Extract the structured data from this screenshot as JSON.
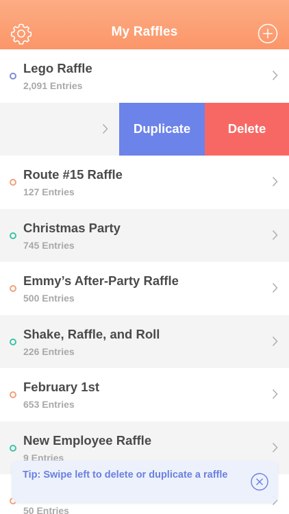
{
  "header": {
    "title": "My Raffles",
    "settings_icon": "gear-icon",
    "add_icon": "plus-circle-icon"
  },
  "colors": {
    "header_top": "#fdac84",
    "header_bottom": "#fb9669",
    "duplicate": "#6c83ea",
    "delete": "#f76864",
    "dot_blue": "#7c8ad8",
    "dot_orange": "#f2a07a",
    "dot_teal": "#3cc3a6",
    "tip_text": "#6a7fe0"
  },
  "swipe_actions": {
    "duplicate_label": "Duplicate",
    "delete_label": "Delete"
  },
  "raffles": [
    {
      "name": "Lego Raffle",
      "entries": "2,091 Entries",
      "dot": "#7c8ad8"
    },
    {
      "name": "Route #15 Raffle",
      "entries": "127 Entries",
      "dot": "#f2a07a"
    },
    {
      "name": "Christmas Party",
      "entries": "745 Entries",
      "dot": "#3cc3a6"
    },
    {
      "name": "Emmy’s After-Party Raffle",
      "entries": "500 Entries",
      "dot": "#f2a07a"
    },
    {
      "name": "Shake, Raffle, and Roll",
      "entries": "226 Entries",
      "dot": "#3cc3a6"
    },
    {
      "name": "February 1st",
      "entries": "653 Entries",
      "dot": "#f2a07a"
    },
    {
      "name": "New Employee Raffle",
      "entries": "9 Entries",
      "dot": "#3cc3a6"
    },
    {
      "name": "",
      "entries": "50 Entries",
      "dot": "#f2a07a"
    }
  ],
  "tip": {
    "text": "Tip: Swipe left to delete or duplicate a raffle",
    "close_icon": "close-circle-icon"
  }
}
